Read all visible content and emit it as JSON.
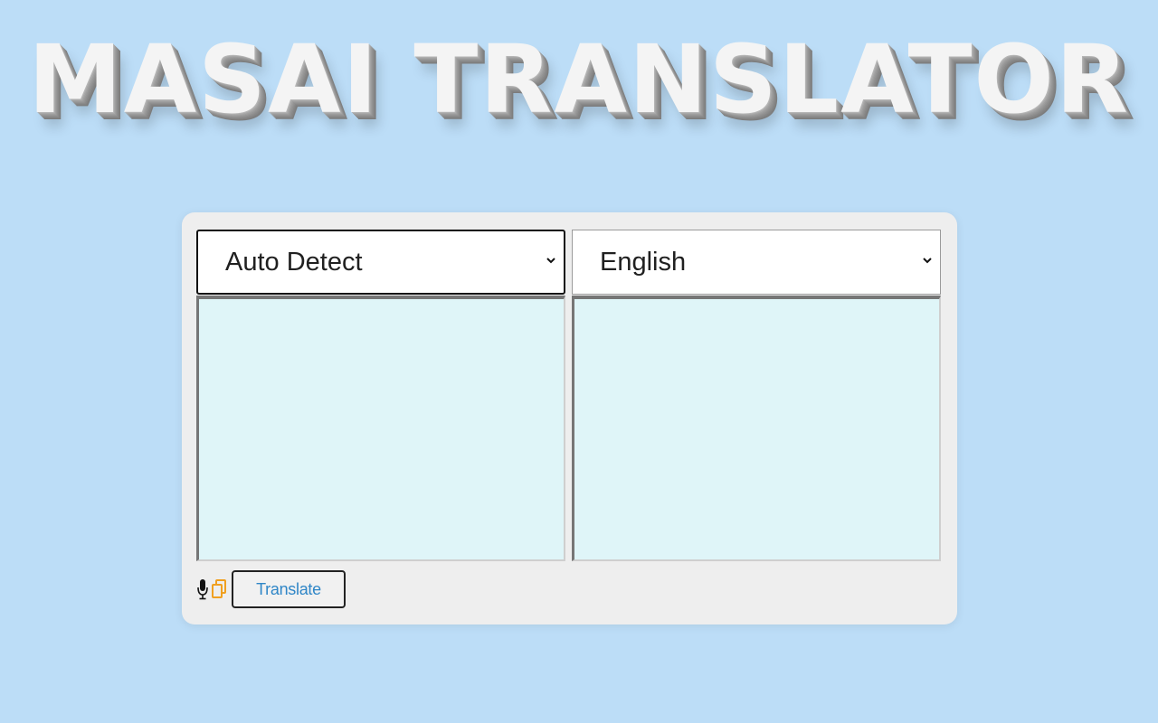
{
  "app": {
    "title": "MASAI TRANSLATOR"
  },
  "translator": {
    "from_language": "Auto Detect",
    "to_language": "English",
    "source_text": "",
    "translated_text": "",
    "translate_label": "Translate"
  },
  "icons": {
    "mic": "microphone-icon",
    "copy": "copy-icon"
  },
  "colors": {
    "background": "#bcddf7",
    "card": "#eeeeee",
    "textarea": "#dff5f8",
    "translate_text": "#2f86c7",
    "copy_icon": "#f0a020"
  }
}
